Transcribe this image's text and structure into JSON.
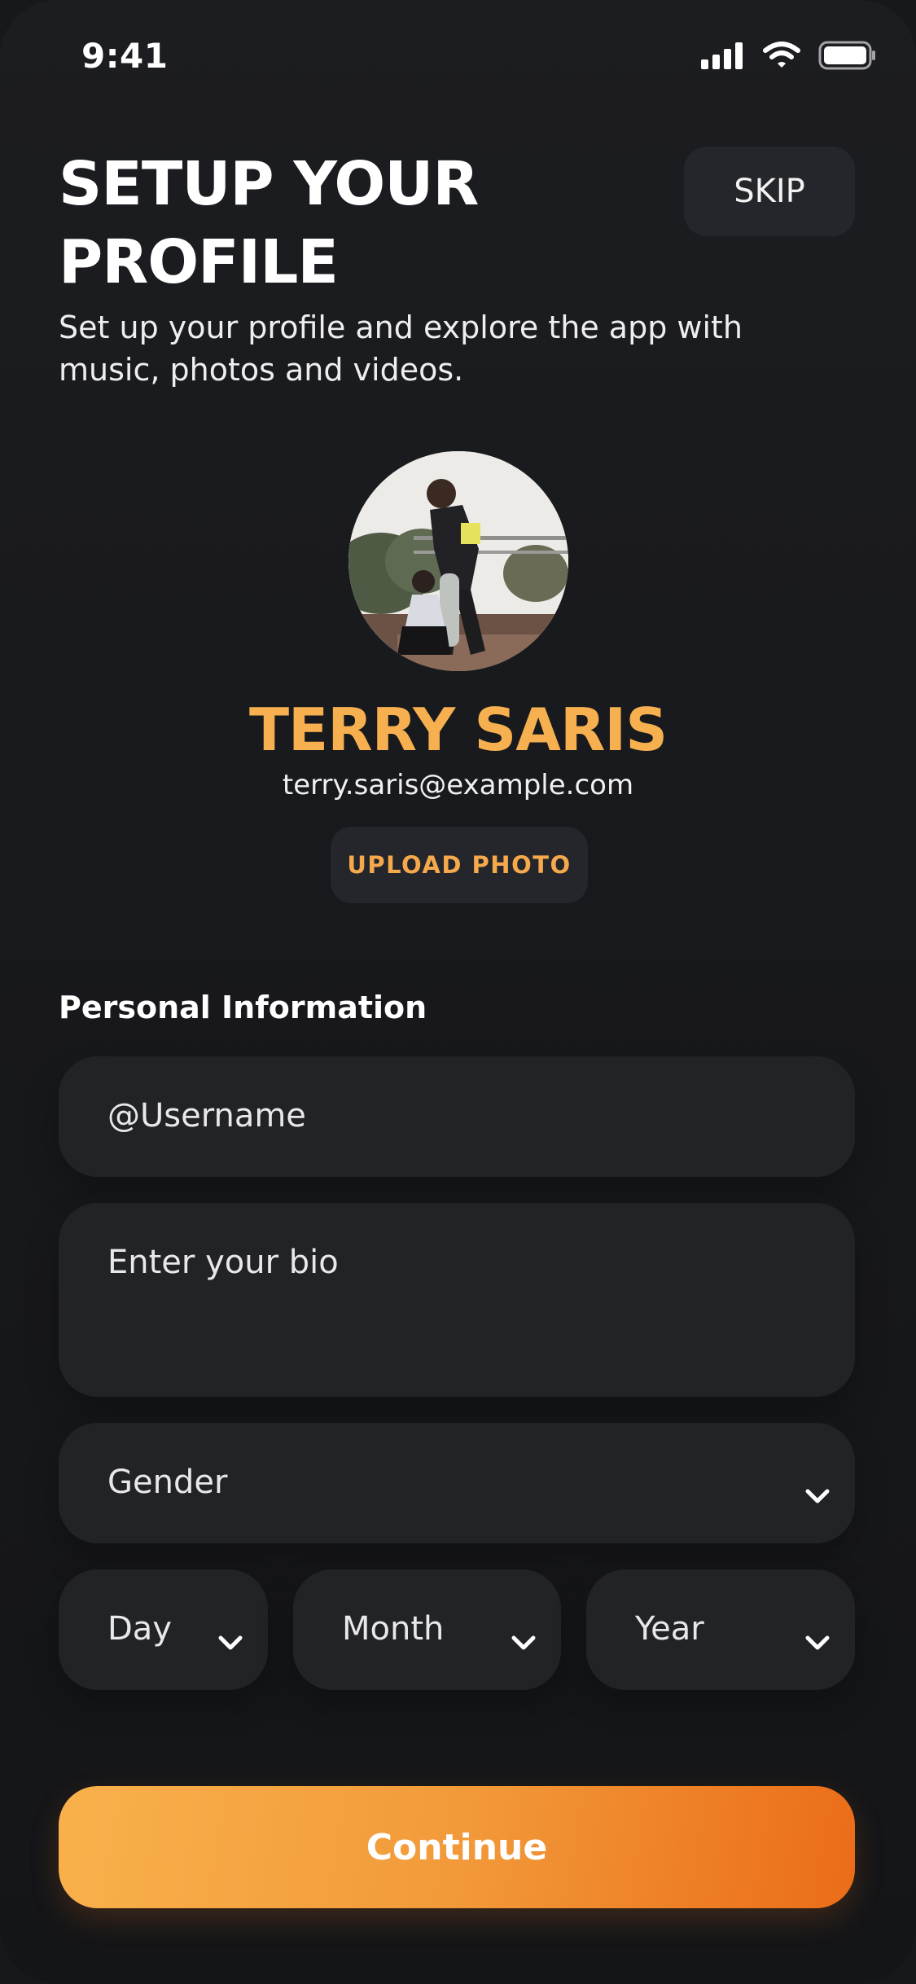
{
  "status_bar": {
    "time": "9:41",
    "icons": [
      "cellular-signal-icon",
      "wifi-icon",
      "battery-icon"
    ]
  },
  "header": {
    "title": "SETUP YOUR PROFILE",
    "skip_label": "SKIP",
    "subtitle": "Set up your profile and explore the app with music, photos and videos."
  },
  "profile": {
    "name": "TERRY SARIS",
    "email": "terry.saris@example.com",
    "upload_label": "UPLOAD PHOTO"
  },
  "form": {
    "section_title": "Personal Information",
    "username_placeholder": "@Username",
    "bio_placeholder": "Enter your bio",
    "gender_placeholder": "Gender",
    "day_placeholder": "Day",
    "month_placeholder": "Month",
    "year_placeholder": "Year"
  },
  "actions": {
    "continue_label": "Continue"
  },
  "colors": {
    "background": "#18191c",
    "surface": "#222327",
    "accent": "#f7b04f",
    "button_gradient_start": "#f9b14c",
    "button_gradient_end": "#eb6c18"
  }
}
